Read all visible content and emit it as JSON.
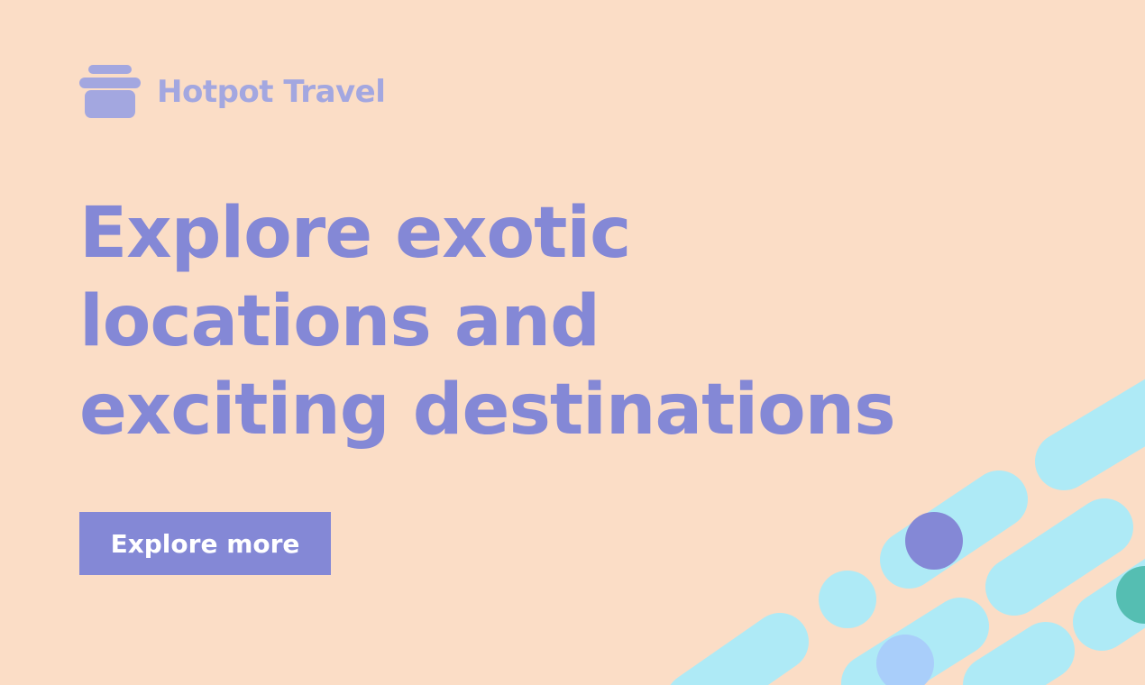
{
  "brand": {
    "name": "Hotpot Travel",
    "icon": "hotpot-icon"
  },
  "hero": {
    "headline_lines": [
      "Explore exotic",
      "locations and",
      "exciting destinations"
    ],
    "cta_label": "Explore more"
  },
  "colors": {
    "background": "#FBDDC6",
    "brand_text": "#A3A7E0",
    "headline": "#8488D6",
    "button": "#8488D6",
    "button_text": "#FFFFFF",
    "pill": "#AEEAF6",
    "dot_purple": "#8488D6",
    "dot_teal": "#55BEB2",
    "dot_blue": "#A9CEFA"
  }
}
